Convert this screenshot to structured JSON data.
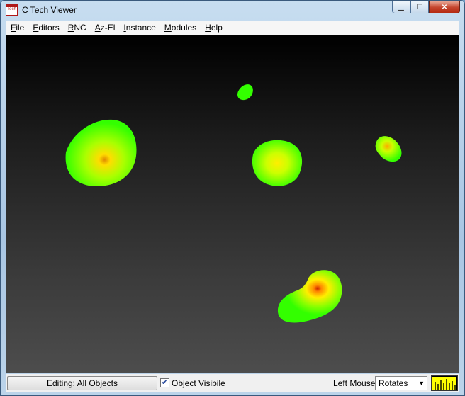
{
  "window": {
    "title": "C Tech Viewer",
    "icon_text": "Tech"
  },
  "titlebar_buttons": {
    "minimize": "▁",
    "maximize": "☐",
    "close": "✕"
  },
  "menu": [
    {
      "label": "File"
    },
    {
      "label": "Editors"
    },
    {
      "label": "RNC"
    },
    {
      "label": "Az-El"
    },
    {
      "label": "Instance"
    },
    {
      "label": "Modules"
    },
    {
      "label": "Help"
    }
  ],
  "viewport": {
    "background_top": "#000000",
    "background_bottom": "#4d4d4d"
  },
  "status": {
    "editing_label": "Editing: All Objects",
    "object_visible": {
      "label": "Object Visibile",
      "checked": true
    },
    "left_mouse_label": "Left Mouse",
    "left_mouse_value": "Rotates"
  },
  "colors": {
    "plume_edge": "#33ff00",
    "plume_mid": "#ffff00",
    "plume_core": "#cc2200",
    "meter": "#ffff00"
  }
}
